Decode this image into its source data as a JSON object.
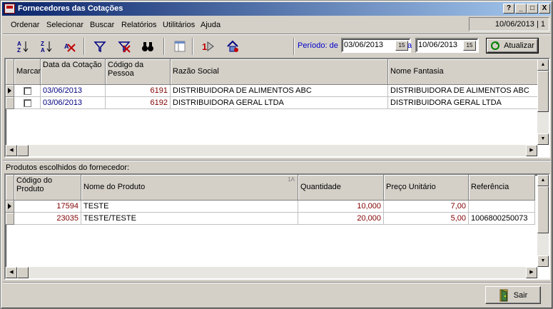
{
  "window": {
    "title": "Fornecedores das Cotações",
    "help_btn": "?",
    "min_btn": "_",
    "max_btn": "□",
    "close_btn": "X"
  },
  "menu": [
    {
      "label": "Ordenar"
    },
    {
      "label": "Selecionar"
    },
    {
      "label": "Buscar"
    },
    {
      "label": "Relatórios"
    },
    {
      "label": "Utilitários"
    },
    {
      "label": "Ajuda"
    }
  ],
  "status_date": "10/06/2013 | 1",
  "toolbar": {
    "period_label": "Período: de",
    "date_from": "03/06/2013",
    "and_label": "a",
    "date_to": "10/06/2013",
    "calendar_glyph": "15",
    "refresh_label": "Atualizar"
  },
  "quotes_grid": {
    "columns": [
      "Marcar",
      "Data da Cotação",
      "Código da Pessoa",
      "Razão Social",
      "Nome Fantasia"
    ],
    "rows": [
      {
        "date": "03/06/2013",
        "code": "6191",
        "razao": "DISTRIBUIDORA DE ALIMENTOS ABC",
        "fantasia": "DISTRIBUIDORA DE ALIMENTOS ABC"
      },
      {
        "date": "03/06/2013",
        "code": "6192",
        "razao": "DISTRIBUIDORA GERAL LTDA",
        "fantasia": "DISTRIBUIDORA GERAL LTDA"
      }
    ]
  },
  "products_caption": "Produtos escolhidos do fornecedor:",
  "products_grid": {
    "columns": [
      "Código do Produto",
      "Nome do Produto",
      "Quantidade",
      "Preço Unitário",
      "Referência"
    ],
    "sort_mark": "1A",
    "rows": [
      {
        "code": "17594",
        "name": "TESTE",
        "qty": "10,000",
        "price": "7,00",
        "ref": ""
      },
      {
        "code": "23035",
        "name": "TESTE/TESTE",
        "qty": "20,000",
        "price": "5,00",
        "ref": "1006800250073"
      }
    ]
  },
  "exit_label": "Sair",
  "colors": {
    "title_start": "#0a246a",
    "title_end": "#a6caf0",
    "link_blue": "#0000cc"
  }
}
